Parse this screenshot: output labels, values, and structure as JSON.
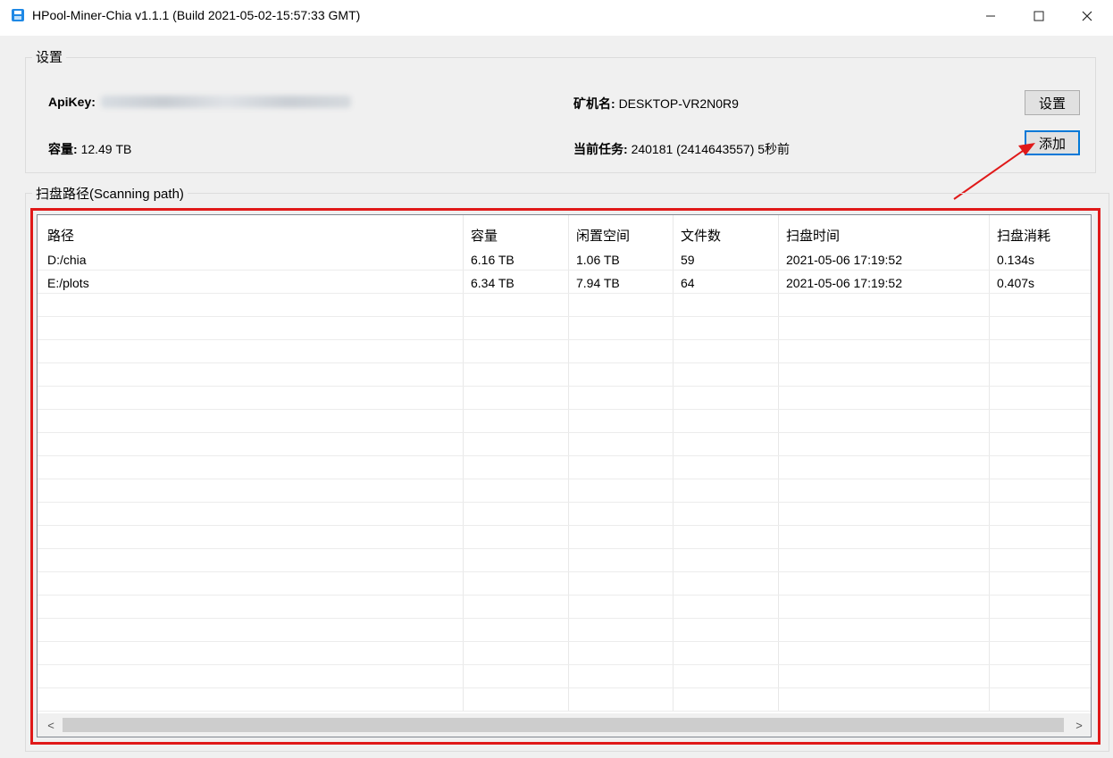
{
  "window": {
    "title": "HPool-Miner-Chia  v1.1.1 (Build 2021-05-02-15:57:33 GMT)",
    "icon": "app-icon",
    "controls": {
      "minimize": "—",
      "maximize": "☐",
      "close": "✕"
    }
  },
  "settings": {
    "legend": "设置",
    "apikey_label": "ApiKey:",
    "capacity_label": "容量:",
    "capacity_value": "12.49 TB",
    "miner_name_label": "矿机名:",
    "miner_name_value": "DESKTOP-VR2N0R9",
    "current_task_label": "当前任务:",
    "current_task_value": "240181   (2414643557) 5秒前",
    "settings_button": "设置",
    "add_button": "添加"
  },
  "scan": {
    "legend": "扫盘路径(Scanning path)",
    "columns": [
      "路径",
      "容量",
      "闲置空间",
      "文件数",
      "扫盘时间",
      "扫盘消耗"
    ],
    "rows": [
      [
        "D:/chia",
        "6.16 TB",
        "1.06 TB",
        "59",
        "2021-05-06 17:19:52",
        "0.134s"
      ],
      [
        "E:/plots",
        "6.34 TB",
        "7.94 TB",
        "64",
        "2021-05-06 17:19:52",
        "0.407s"
      ]
    ],
    "scroll_left": "<",
    "scroll_right": ">"
  },
  "colors": {
    "highlight": "#e01919",
    "focus": "#0078d7",
    "icon": "#1e88e5"
  }
}
